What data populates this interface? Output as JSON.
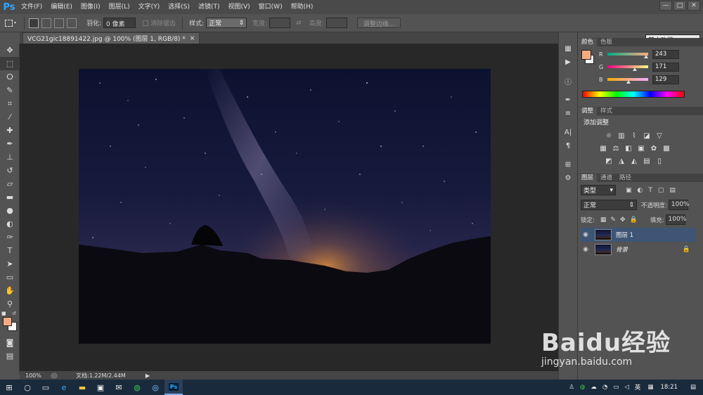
{
  "app": {
    "logo": "Ps"
  },
  "menu": [
    "文件(F)",
    "编辑(E)",
    "图像(I)",
    "图层(L)",
    "文字(Y)",
    "选择(S)",
    "滤镜(T)",
    "视图(V)",
    "窗口(W)",
    "帮助(H)"
  ],
  "window_controls": [
    "—",
    "□",
    "✕"
  ],
  "options": {
    "feather_label": "羽化:",
    "feather_value": "0 像素",
    "antialias_label": "消除锯齿",
    "style_label": "样式:",
    "style_value": "正常",
    "width_label": "宽度:",
    "height_label": "高度:",
    "refine_edge_label": "调整边缘...",
    "workspace": "基本功能"
  },
  "document": {
    "tab_title": "VCG21gic18891422.jpg @ 100% (图层 1, RGB/8) *",
    "tab_close": "×",
    "zoom": "100%",
    "doc_info": "文档:1.22M/2.44M"
  },
  "color_panel": {
    "tabs": [
      "颜色",
      "色板"
    ],
    "fg_color": "#f3ab81",
    "bg_color": "#ffffff",
    "channels": [
      {
        "letter": "R",
        "value": "243",
        "level": 0.95
      },
      {
        "letter": "G",
        "value": "171",
        "level": 0.67
      },
      {
        "letter": "B",
        "value": "129",
        "level": 0.51
      }
    ]
  },
  "adjustments_panel": {
    "tabs": [
      "调整",
      "样式"
    ],
    "title": "添加调整",
    "row1_icons": [
      "brightness-contrast-icon",
      "levels-icon",
      "curves-icon",
      "exposure-icon",
      "vibrance-icon"
    ],
    "row2_icons": [
      "hue-saturation-icon",
      "color-balance-icon",
      "black-white-icon",
      "photo-filter-icon",
      "channel-mixer-icon",
      "color-lookup-icon"
    ],
    "row3_icons": [
      "invert-icon",
      "posterize-icon",
      "threshold-icon",
      "selective-color-icon",
      "gradient-map-icon"
    ]
  },
  "layers_panel": {
    "tabs": [
      "图层",
      "通道",
      "路径"
    ],
    "filter_kind": "类型",
    "blend_mode": "正常",
    "opacity_label": "不透明度:",
    "opacity_value": "100%",
    "lock_label": "锁定:",
    "fill_label": "填充:",
    "fill_value": "100%",
    "layers": [
      {
        "name": "图层 1",
        "selected": true
      },
      {
        "name": "背景",
        "selected": false
      }
    ]
  },
  "taskbar": {
    "time": "18:21",
    "ime": "英"
  },
  "watermark": {
    "brand": "Baidu经验",
    "url": "jingyan.baidu.com"
  }
}
